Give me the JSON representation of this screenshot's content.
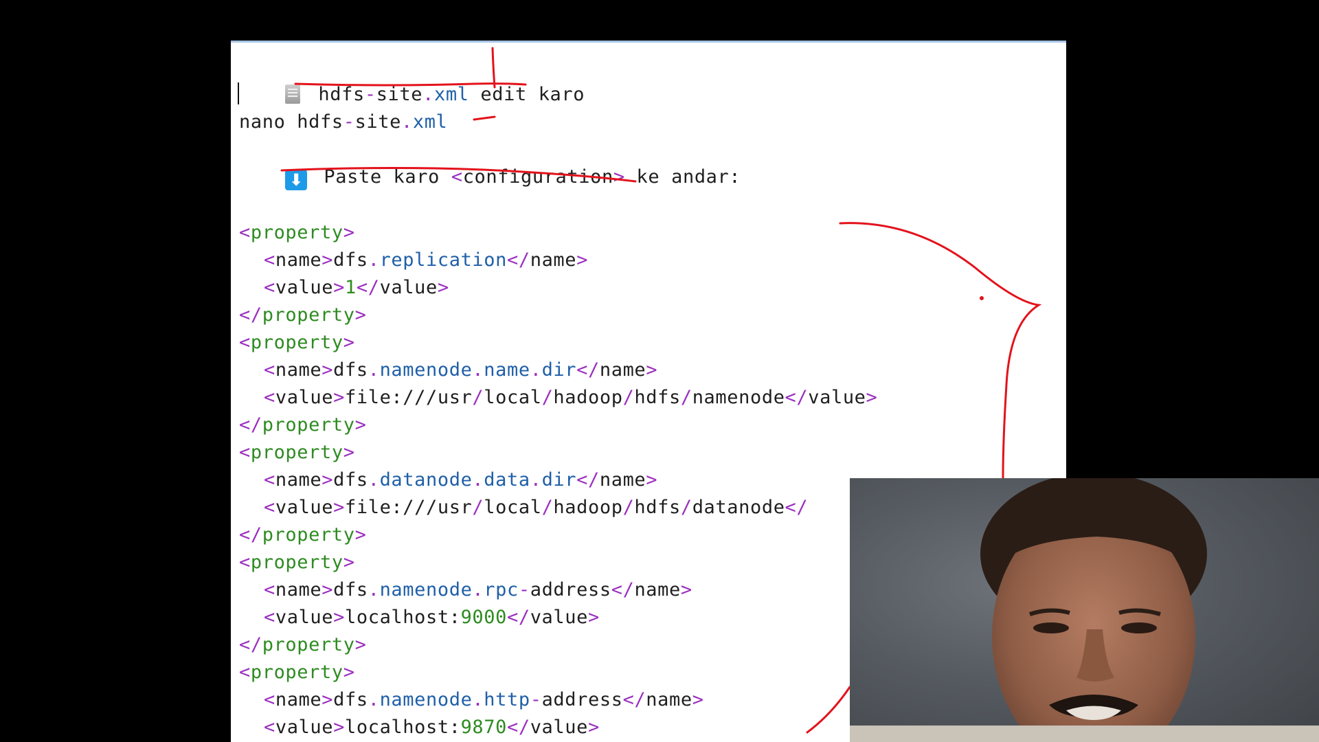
{
  "heading": {
    "icon": "document-icon",
    "parts": [
      {
        "text": "hdfs",
        "cls": "txt"
      },
      {
        "text": "-",
        "cls": "punc"
      },
      {
        "text": "site",
        "cls": "txt"
      },
      {
        "text": ".",
        "cls": "punc"
      },
      {
        "text": "xml",
        "cls": "attr"
      },
      {
        "text": " edit karo",
        "cls": "txt"
      }
    ]
  },
  "command": {
    "parts": [
      {
        "text": "nano hdfs",
        "cls": "txt"
      },
      {
        "text": "-",
        "cls": "punc"
      },
      {
        "text": "site",
        "cls": "txt"
      },
      {
        "text": ".",
        "cls": "punc"
      },
      {
        "text": "xml",
        "cls": "attr"
      }
    ]
  },
  "instruction": {
    "icon": "down-arrow-icon",
    "parts": [
      {
        "text": "Paste karo ",
        "cls": "txt"
      },
      {
        "text": "<",
        "cls": "punc"
      },
      {
        "text": "configuration",
        "cls": "txt"
      },
      {
        "text": ">",
        "cls": "punc"
      },
      {
        "text": " ke andar:",
        "cls": "txt"
      }
    ]
  },
  "xml_lines": [
    [
      [
        "<",
        "punc"
      ],
      [
        "property",
        "tag"
      ],
      [
        ">",
        "punc"
      ]
    ],
    [
      [
        "  ",
        "ind"
      ],
      [
        "<",
        "punc"
      ],
      [
        "name",
        "txt"
      ],
      [
        ">",
        "punc"
      ],
      [
        "dfs",
        "txt"
      ],
      [
        ".",
        "punc"
      ],
      [
        "replication",
        "attr"
      ],
      [
        "</",
        "punc"
      ],
      [
        "name",
        "txt"
      ],
      [
        ">",
        "punc"
      ]
    ],
    [
      [
        "  ",
        "ind"
      ],
      [
        "<",
        "punc"
      ],
      [
        "value",
        "txt"
      ],
      [
        ">",
        "punc"
      ],
      [
        "1",
        "num"
      ],
      [
        "</",
        "punc"
      ],
      [
        "value",
        "txt"
      ],
      [
        ">",
        "punc"
      ]
    ],
    [
      [
        "</",
        "punc"
      ],
      [
        "property",
        "tag"
      ],
      [
        ">",
        "punc"
      ]
    ],
    [
      [
        "<",
        "punc"
      ],
      [
        "property",
        "tag"
      ],
      [
        ">",
        "punc"
      ]
    ],
    [
      [
        "  ",
        "ind"
      ],
      [
        "<",
        "punc"
      ],
      [
        "name",
        "txt"
      ],
      [
        ">",
        "punc"
      ],
      [
        "dfs",
        "txt"
      ],
      [
        ".",
        "punc"
      ],
      [
        "namenode",
        "attr"
      ],
      [
        ".",
        "punc"
      ],
      [
        "name",
        "attr"
      ],
      [
        ".",
        "punc"
      ],
      [
        "dir",
        "attr"
      ],
      [
        "</",
        "punc"
      ],
      [
        "name",
        "txt"
      ],
      [
        ">",
        "punc"
      ]
    ],
    [
      [
        "  ",
        "ind"
      ],
      [
        "<",
        "punc"
      ],
      [
        "value",
        "txt"
      ],
      [
        ">",
        "punc"
      ],
      [
        "file:///usr",
        "txt"
      ],
      [
        "/",
        "punc"
      ],
      [
        "local",
        "txt"
      ],
      [
        "/",
        "punc"
      ],
      [
        "hadoop",
        "txt"
      ],
      [
        "/",
        "punc"
      ],
      [
        "hdfs",
        "txt"
      ],
      [
        "/",
        "punc"
      ],
      [
        "namenode",
        "txt"
      ],
      [
        "</",
        "punc"
      ],
      [
        "value",
        "txt"
      ],
      [
        ">",
        "punc"
      ]
    ],
    [
      [
        "</",
        "punc"
      ],
      [
        "property",
        "tag"
      ],
      [
        ">",
        "punc"
      ]
    ],
    [
      [
        "<",
        "punc"
      ],
      [
        "property",
        "tag"
      ],
      [
        ">",
        "punc"
      ]
    ],
    [
      [
        "  ",
        "ind"
      ],
      [
        "<",
        "punc"
      ],
      [
        "name",
        "txt"
      ],
      [
        ">",
        "punc"
      ],
      [
        "dfs",
        "txt"
      ],
      [
        ".",
        "punc"
      ],
      [
        "datanode",
        "attr"
      ],
      [
        ".",
        "punc"
      ],
      [
        "data",
        "attr"
      ],
      [
        ".",
        "punc"
      ],
      [
        "dir",
        "attr"
      ],
      [
        "</",
        "punc"
      ],
      [
        "name",
        "txt"
      ],
      [
        ">",
        "punc"
      ]
    ],
    [
      [
        "  ",
        "ind"
      ],
      [
        "<",
        "punc"
      ],
      [
        "value",
        "txt"
      ],
      [
        ">",
        "punc"
      ],
      [
        "file:///usr",
        "txt"
      ],
      [
        "/",
        "punc"
      ],
      [
        "local",
        "txt"
      ],
      [
        "/",
        "punc"
      ],
      [
        "hadoop",
        "txt"
      ],
      [
        "/",
        "punc"
      ],
      [
        "hdfs",
        "txt"
      ],
      [
        "/",
        "punc"
      ],
      [
        "datanode",
        "txt"
      ],
      [
        "</",
        "punc"
      ]
    ],
    [
      [
        "</",
        "punc"
      ],
      [
        "property",
        "tag"
      ],
      [
        ">",
        "punc"
      ]
    ],
    [
      [
        "<",
        "punc"
      ],
      [
        "property",
        "tag"
      ],
      [
        ">",
        "punc"
      ]
    ],
    [
      [
        "  ",
        "ind"
      ],
      [
        "<",
        "punc"
      ],
      [
        "name",
        "txt"
      ],
      [
        ">",
        "punc"
      ],
      [
        "dfs",
        "txt"
      ],
      [
        ".",
        "punc"
      ],
      [
        "namenode",
        "attr"
      ],
      [
        ".",
        "punc"
      ],
      [
        "rpc",
        "attr"
      ],
      [
        "-",
        "punc"
      ],
      [
        "address",
        "txt"
      ],
      [
        "</",
        "punc"
      ],
      [
        "name",
        "txt"
      ],
      [
        ">",
        "punc"
      ]
    ],
    [
      [
        "  ",
        "ind"
      ],
      [
        "<",
        "punc"
      ],
      [
        "value",
        "txt"
      ],
      [
        ">",
        "punc"
      ],
      [
        "localhost:",
        "txt"
      ],
      [
        "9000",
        "num"
      ],
      [
        "</",
        "punc"
      ],
      [
        "value",
        "txt"
      ],
      [
        ">",
        "punc"
      ]
    ],
    [
      [
        "</",
        "punc"
      ],
      [
        "property",
        "tag"
      ],
      [
        ">",
        "punc"
      ]
    ],
    [
      [
        "<",
        "punc"
      ],
      [
        "property",
        "tag"
      ],
      [
        ">",
        "punc"
      ]
    ],
    [
      [
        "  ",
        "ind"
      ],
      [
        "<",
        "punc"
      ],
      [
        "name",
        "txt"
      ],
      [
        ">",
        "punc"
      ],
      [
        "dfs",
        "txt"
      ],
      [
        ".",
        "punc"
      ],
      [
        "namenode",
        "attr"
      ],
      [
        ".",
        "punc"
      ],
      [
        "http",
        "attr"
      ],
      [
        "-",
        "punc"
      ],
      [
        "address",
        "txt"
      ],
      [
        "</",
        "punc"
      ],
      [
        "name",
        "txt"
      ],
      [
        ">",
        "punc"
      ]
    ],
    [
      [
        "  ",
        "ind"
      ],
      [
        "<",
        "punc"
      ],
      [
        "value",
        "txt"
      ],
      [
        ">",
        "punc"
      ],
      [
        "localhost:",
        "txt"
      ],
      [
        "9870",
        "num"
      ],
      [
        "</",
        "punc"
      ],
      [
        "value",
        "txt"
      ],
      [
        ">",
        "punc"
      ]
    ]
  ],
  "colors": {
    "tag": "#2e8b21",
    "punctuation": "#9b2fbf",
    "keyword": "#1f5fa8",
    "annotation": "#e3121b",
    "background": "#000000"
  },
  "webcam": {
    "icon": "presenter-video"
  }
}
